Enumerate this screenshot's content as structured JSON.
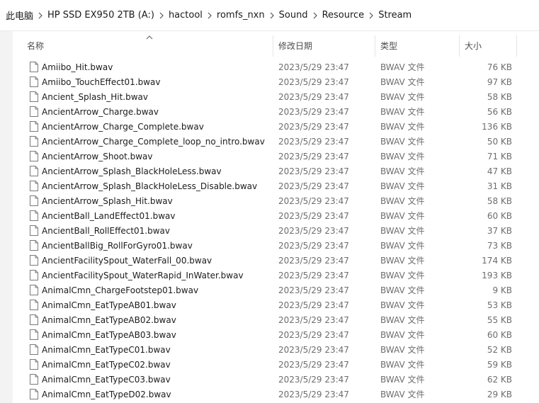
{
  "breadcrumb": [
    "此电脑",
    "HP SSD EX950 2TB (A:)",
    "hactool",
    "romfs_nxn",
    "Sound",
    "Resource",
    "Stream"
  ],
  "columns": {
    "name": "名称",
    "date": "修改日期",
    "type": "类型",
    "size": "大小"
  },
  "files": [
    {
      "name": "Amiibo_Hit.bwav",
      "date": "2023/5/29 23:47",
      "type": "BWAV 文件",
      "size": "76 KB"
    },
    {
      "name": "Amiibo_TouchEffect01.bwav",
      "date": "2023/5/29 23:47",
      "type": "BWAV 文件",
      "size": "97 KB"
    },
    {
      "name": "Ancient_Splash_Hit.bwav",
      "date": "2023/5/29 23:47",
      "type": "BWAV 文件",
      "size": "58 KB"
    },
    {
      "name": "AncientArrow_Charge.bwav",
      "date": "2023/5/29 23:47",
      "type": "BWAV 文件",
      "size": "56 KB"
    },
    {
      "name": "AncientArrow_Charge_Complete.bwav",
      "date": "2023/5/29 23:47",
      "type": "BWAV 文件",
      "size": "136 KB"
    },
    {
      "name": "AncientArrow_Charge_Complete_loop_no_intro.bwav",
      "date": "2023/5/29 23:47",
      "type": "BWAV 文件",
      "size": "50 KB"
    },
    {
      "name": "AncientArrow_Shoot.bwav",
      "date": "2023/5/29 23:47",
      "type": "BWAV 文件",
      "size": "71 KB"
    },
    {
      "name": "AncientArrow_Splash_BlackHoleLess.bwav",
      "date": "2023/5/29 23:47",
      "type": "BWAV 文件",
      "size": "47 KB"
    },
    {
      "name": "AncientArrow_Splash_BlackHoleLess_Disable.bwav",
      "date": "2023/5/29 23:47",
      "type": "BWAV 文件",
      "size": "31 KB"
    },
    {
      "name": "AncientArrow_Splash_Hit.bwav",
      "date": "2023/5/29 23:47",
      "type": "BWAV 文件",
      "size": "58 KB"
    },
    {
      "name": "AncientBall_LandEffect01.bwav",
      "date": "2023/5/29 23:47",
      "type": "BWAV 文件",
      "size": "60 KB"
    },
    {
      "name": "AncientBall_RollEffect01.bwav",
      "date": "2023/5/29 23:47",
      "type": "BWAV 文件",
      "size": "37 KB"
    },
    {
      "name": "AncientBallBig_RollForGyro01.bwav",
      "date": "2023/5/29 23:47",
      "type": "BWAV 文件",
      "size": "73 KB"
    },
    {
      "name": "AncientFacilitySpout_WaterFall_00.bwav",
      "date": "2023/5/29 23:47",
      "type": "BWAV 文件",
      "size": "174 KB"
    },
    {
      "name": "AncientFacilitySpout_WaterRapid_InWater.bwav",
      "date": "2023/5/29 23:47",
      "type": "BWAV 文件",
      "size": "193 KB"
    },
    {
      "name": "AnimalCmn_ChargeFootstep01.bwav",
      "date": "2023/5/29 23:47",
      "type": "BWAV 文件",
      "size": "9 KB"
    },
    {
      "name": "AnimalCmn_EatTypeAB01.bwav",
      "date": "2023/5/29 23:47",
      "type": "BWAV 文件",
      "size": "53 KB"
    },
    {
      "name": "AnimalCmn_EatTypeAB02.bwav",
      "date": "2023/5/29 23:47",
      "type": "BWAV 文件",
      "size": "55 KB"
    },
    {
      "name": "AnimalCmn_EatTypeAB03.bwav",
      "date": "2023/5/29 23:47",
      "type": "BWAV 文件",
      "size": "60 KB"
    },
    {
      "name": "AnimalCmn_EatTypeC01.bwav",
      "date": "2023/5/29 23:47",
      "type": "BWAV 文件",
      "size": "52 KB"
    },
    {
      "name": "AnimalCmn_EatTypeC02.bwav",
      "date": "2023/5/29 23:47",
      "type": "BWAV 文件",
      "size": "59 KB"
    },
    {
      "name": "AnimalCmn_EatTypeC03.bwav",
      "date": "2023/5/29 23:47",
      "type": "BWAV 文件",
      "size": "62 KB"
    },
    {
      "name": "AnimalCmn_EatTypeD02.bwav",
      "date": "2023/5/29 23:47",
      "type": "BWAV 文件",
      "size": "29 KB"
    }
  ],
  "icons": {
    "separator": "chevron-right-icon",
    "file": "file-icon",
    "sort": "sort-ascending-icon"
  }
}
